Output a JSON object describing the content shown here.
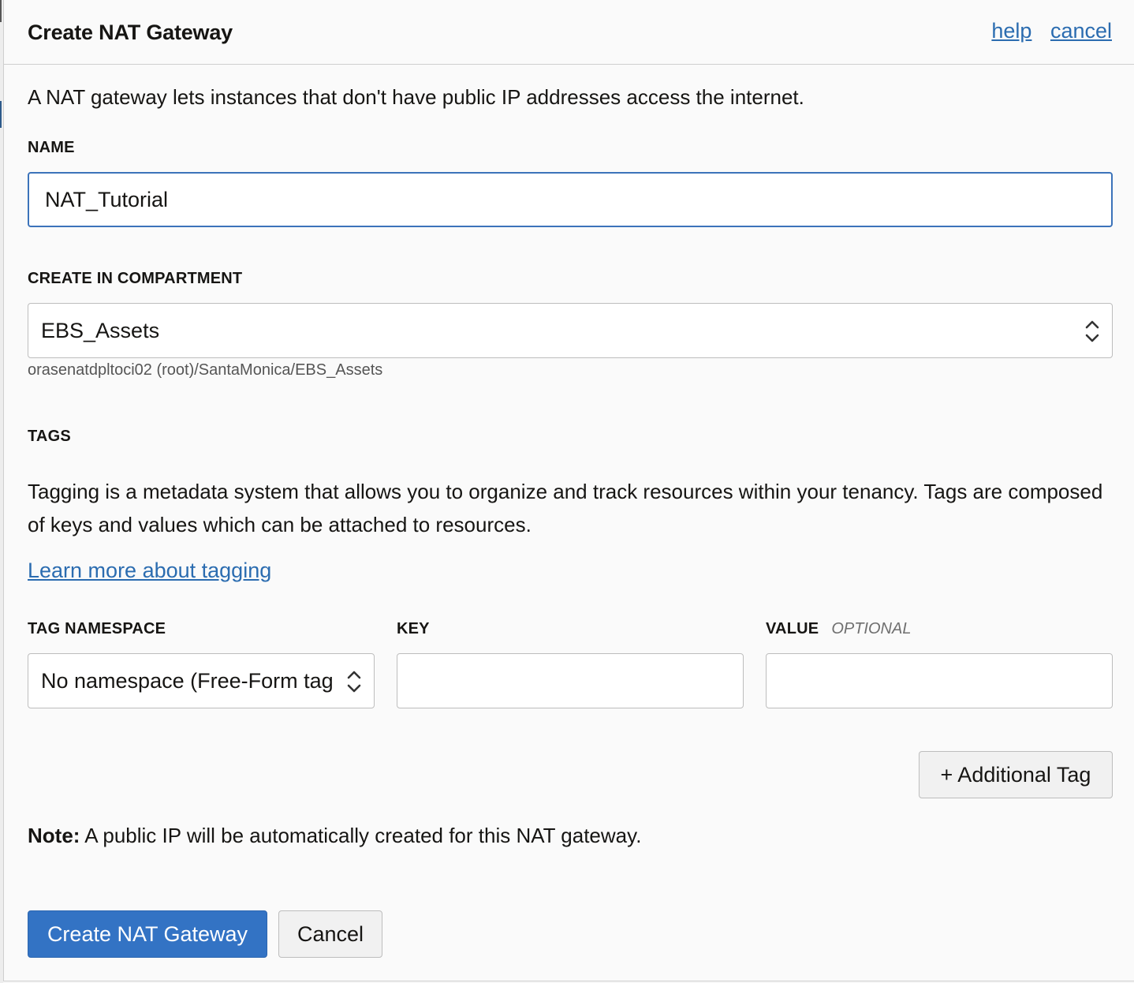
{
  "dialog": {
    "title": "Create NAT Gateway",
    "help_link": "help",
    "cancel_link": "cancel",
    "intro": "A NAT gateway lets instances that don't have public IP addresses access the internet."
  },
  "name_field": {
    "label": "NAME",
    "value": "NAT_Tutorial"
  },
  "compartment": {
    "label": "CREATE IN COMPARTMENT",
    "selected": "EBS_Assets",
    "path": "orasenatdpltoci02 (root)/SantaMonica/EBS_Assets"
  },
  "tags": {
    "heading": "TAGS",
    "description": "Tagging is a metadata system that allows you to organize and track resources within your tenancy. Tags are composed of keys and values which can be attached to resources.",
    "learn_more": "Learn more about tagging",
    "namespace_label": "TAG NAMESPACE",
    "namespace_selected": "No namespace (Free-Form tag",
    "key_label": "KEY",
    "key_value": "",
    "value_label": "VALUE",
    "value_optional": "OPTIONAL",
    "value_value": "",
    "add_button": "+ Additional Tag"
  },
  "note": {
    "prefix": "Note:",
    "text": " A public IP will be automatically created for this NAT gateway."
  },
  "footer": {
    "primary_button": "Create NAT Gateway",
    "cancel_button": "Cancel"
  },
  "colors": {
    "accent": "#3373c4",
    "link": "#2b6cb0",
    "focus_border": "#3c73ba"
  },
  "icons": {
    "select_indicator": "up-down-chevron-icon"
  }
}
